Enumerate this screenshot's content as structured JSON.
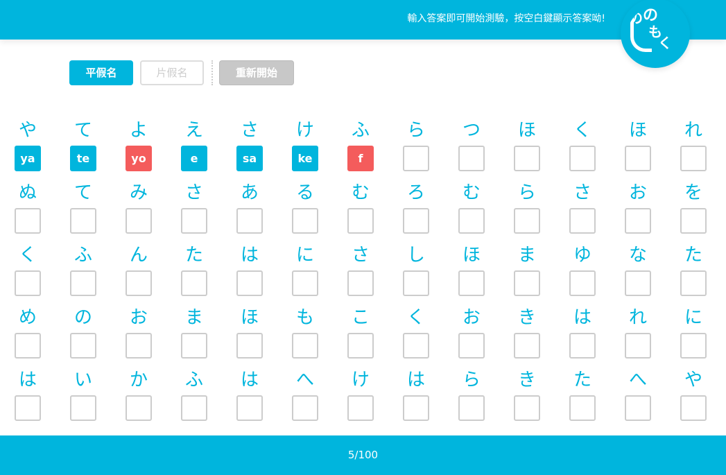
{
  "header": {
    "message": "輸入答案即可開始測驗，按空白鍵顯示答案呦!",
    "logo_text": [
      "の",
      "の",
      "も",
      "く"
    ]
  },
  "toolbar": {
    "hiragana_label": "平假名",
    "katakana_label": "片假名",
    "restart_label": "重新開始"
  },
  "rows": [
    [
      {
        "kana": "や",
        "answer": "ya",
        "status": "correct"
      },
      {
        "kana": "て",
        "answer": "te",
        "status": "correct"
      },
      {
        "kana": "よ",
        "answer": "yo",
        "status": "wrong"
      },
      {
        "kana": "え",
        "answer": "e",
        "status": "correct"
      },
      {
        "kana": "さ",
        "answer": "sa",
        "status": "correct"
      },
      {
        "kana": "け",
        "answer": "ke",
        "status": "correct"
      },
      {
        "kana": "ふ",
        "answer": "f",
        "status": "wrong"
      },
      {
        "kana": "ら",
        "answer": "",
        "status": "empty"
      },
      {
        "kana": "つ",
        "answer": "",
        "status": "empty"
      },
      {
        "kana": "ほ",
        "answer": "",
        "status": "empty"
      },
      {
        "kana": "く",
        "answer": "",
        "status": "empty"
      },
      {
        "kana": "ほ",
        "answer": "",
        "status": "empty"
      },
      {
        "kana": "れ",
        "answer": "",
        "status": "empty"
      }
    ],
    [
      {
        "kana": "ぬ",
        "answer": "",
        "status": "empty"
      },
      {
        "kana": "て",
        "answer": "",
        "status": "empty"
      },
      {
        "kana": "み",
        "answer": "",
        "status": "empty"
      },
      {
        "kana": "さ",
        "answer": "",
        "status": "empty"
      },
      {
        "kana": "あ",
        "answer": "",
        "status": "empty"
      },
      {
        "kana": "る",
        "answer": "",
        "status": "empty"
      },
      {
        "kana": "む",
        "answer": "",
        "status": "empty"
      },
      {
        "kana": "ろ",
        "answer": "",
        "status": "empty"
      },
      {
        "kana": "む",
        "answer": "",
        "status": "empty"
      },
      {
        "kana": "ら",
        "answer": "",
        "status": "empty"
      },
      {
        "kana": "さ",
        "answer": "",
        "status": "empty"
      },
      {
        "kana": "お",
        "answer": "",
        "status": "empty"
      },
      {
        "kana": "を",
        "answer": "",
        "status": "empty"
      }
    ],
    [
      {
        "kana": "く",
        "answer": "",
        "status": "empty"
      },
      {
        "kana": "ふ",
        "answer": "",
        "status": "empty"
      },
      {
        "kana": "ん",
        "answer": "",
        "status": "empty"
      },
      {
        "kana": "た",
        "answer": "",
        "status": "empty"
      },
      {
        "kana": "は",
        "answer": "",
        "status": "empty"
      },
      {
        "kana": "に",
        "answer": "",
        "status": "empty"
      },
      {
        "kana": "さ",
        "answer": "",
        "status": "empty"
      },
      {
        "kana": "し",
        "answer": "",
        "status": "empty"
      },
      {
        "kana": "ほ",
        "answer": "",
        "status": "empty"
      },
      {
        "kana": "ま",
        "answer": "",
        "status": "empty"
      },
      {
        "kana": "ゆ",
        "answer": "",
        "status": "empty"
      },
      {
        "kana": "な",
        "answer": "",
        "status": "empty"
      },
      {
        "kana": "た",
        "answer": "",
        "status": "empty"
      }
    ],
    [
      {
        "kana": "め",
        "answer": "",
        "status": "empty"
      },
      {
        "kana": "の",
        "answer": "",
        "status": "empty"
      },
      {
        "kana": "お",
        "answer": "",
        "status": "empty"
      },
      {
        "kana": "ま",
        "answer": "",
        "status": "empty"
      },
      {
        "kana": "ほ",
        "answer": "",
        "status": "empty"
      },
      {
        "kana": "も",
        "answer": "",
        "status": "empty"
      },
      {
        "kana": "こ",
        "answer": "",
        "status": "empty"
      },
      {
        "kana": "く",
        "answer": "",
        "status": "empty"
      },
      {
        "kana": "お",
        "answer": "",
        "status": "empty"
      },
      {
        "kana": "き",
        "answer": "",
        "status": "empty"
      },
      {
        "kana": "は",
        "answer": "",
        "status": "empty"
      },
      {
        "kana": "れ",
        "answer": "",
        "status": "empty"
      },
      {
        "kana": "に",
        "answer": "",
        "status": "empty"
      }
    ],
    [
      {
        "kana": "は",
        "answer": "",
        "status": "empty"
      },
      {
        "kana": "い",
        "answer": "",
        "status": "empty"
      },
      {
        "kana": "か",
        "answer": "",
        "status": "empty"
      },
      {
        "kana": "ふ",
        "answer": "",
        "status": "empty"
      },
      {
        "kana": "は",
        "answer": "",
        "status": "empty"
      },
      {
        "kana": "へ",
        "answer": "",
        "status": "empty"
      },
      {
        "kana": "け",
        "answer": "",
        "status": "empty"
      },
      {
        "kana": "は",
        "answer": "",
        "status": "empty"
      },
      {
        "kana": "ら",
        "answer": "",
        "status": "empty"
      },
      {
        "kana": "き",
        "answer": "",
        "status": "empty"
      },
      {
        "kana": "た",
        "answer": "",
        "status": "empty"
      },
      {
        "kana": "へ",
        "answer": "",
        "status": "empty"
      },
      {
        "kana": "や",
        "answer": "",
        "status": "empty"
      }
    ]
  ],
  "footer": {
    "progress": "5/100"
  },
  "colors": {
    "accent": "#00b5dd",
    "correct": "#00b5dd",
    "wrong": "#f45c5c",
    "empty_border": "#cccccc"
  }
}
